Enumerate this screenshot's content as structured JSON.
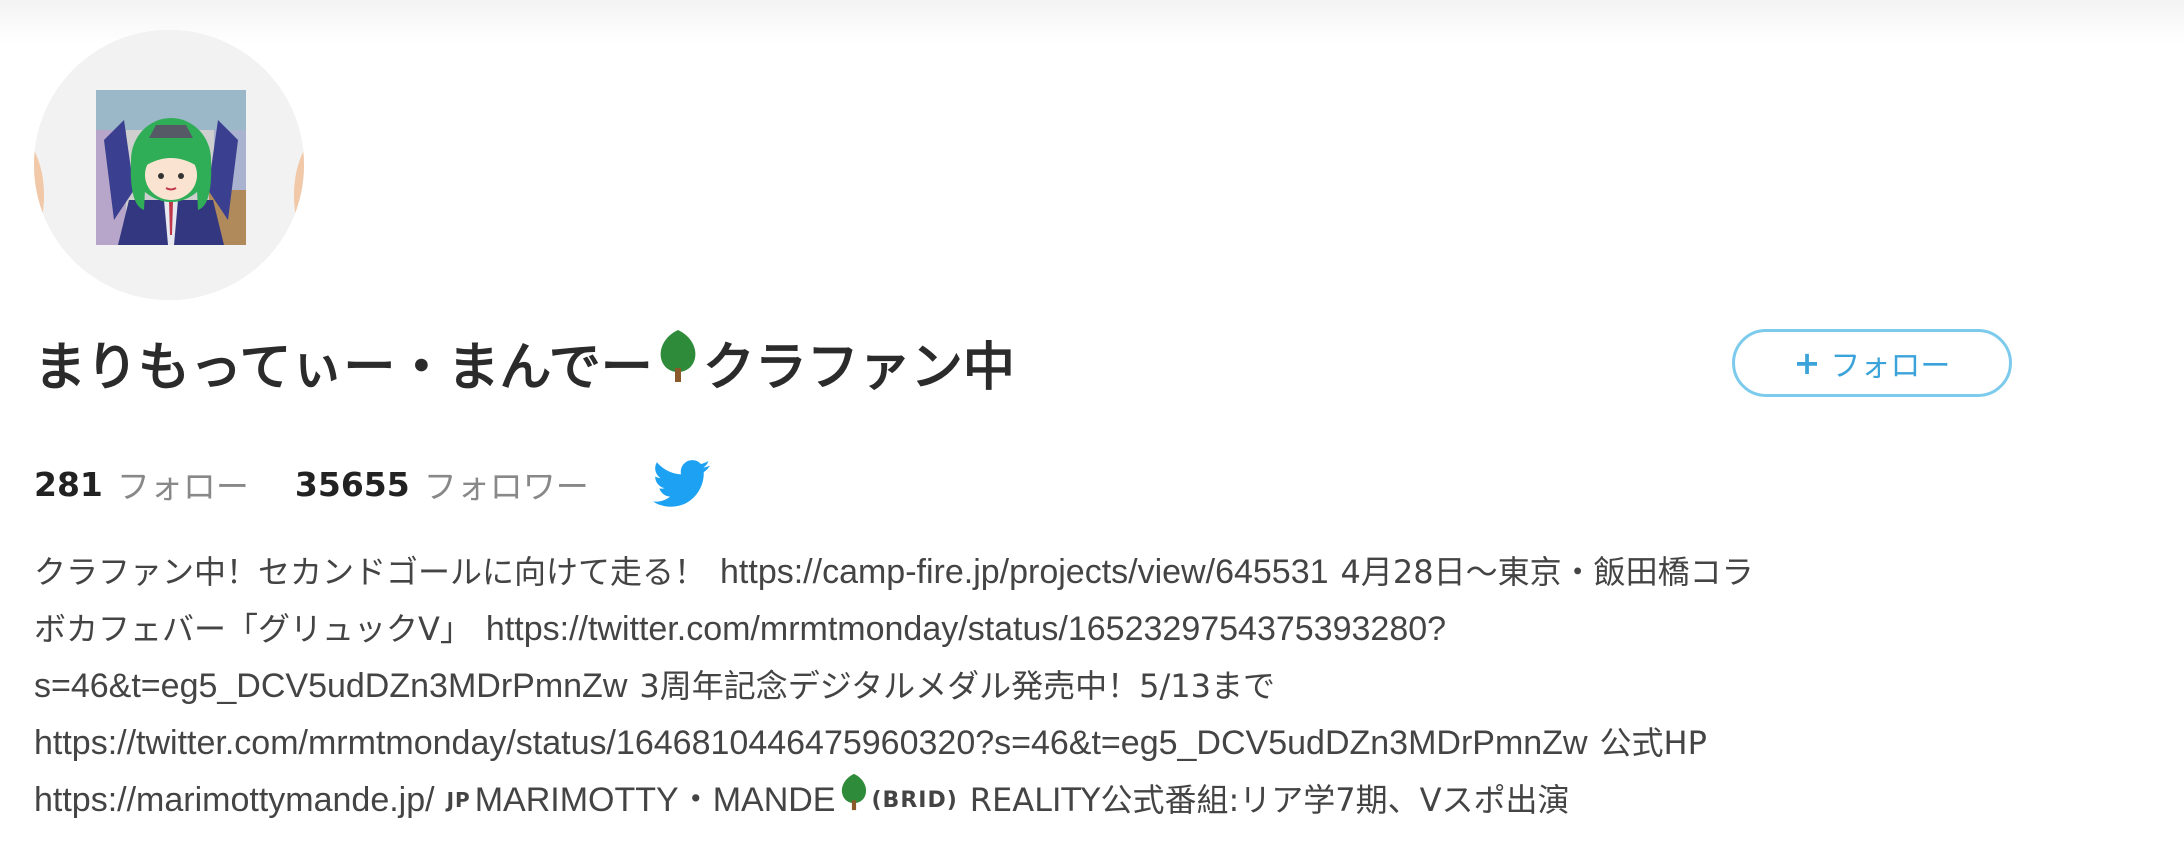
{
  "profile": {
    "display_name_part1": "まりもってぃー・まんでー",
    "display_name_part2": "クラファン中",
    "follow_button_label": "フォロー",
    "follow_button_icon": "plus-icon"
  },
  "stats": {
    "following_count": "281",
    "following_label": "フォロー",
    "followers_count": "35655",
    "followers_label": "フォロワー",
    "platform_icon": "twitter-bird-icon"
  },
  "bio": {
    "line1_text": "クラファン中！セカンドゴールに向けて走る！",
    "line1_url": "https://camp-fire.jp/projects/view/645531",
    "line1_tail": "4月28日〜東京・飯田橋コラ",
    "line2_text": "ボカフェバー「グリュックV」",
    "line2_url": "https://twitter.com/mrmtmonday/status/1652329754375393280?",
    "line3_url": "s=46&t=eg5_DCV5udDZn3MDrPmnZw",
    "line3_tail": "3周年記念デジタルメダル発売中！5/13まで",
    "line4_url": "https://twitter.com/mrmtmonday/status/1646810446475960320?s=46&t=eg5_DCV5udDZn3MDrPmnZw",
    "line4_tail": "公式HP",
    "line5_url": "https://marimottymande.jp/",
    "line5_flag": "JP",
    "line5_name": "MARIMOTTY・MANDE",
    "line5_brid": "(BRID)",
    "line5_tail": "REALITY公式番組:リア学7期、Vスポ出演"
  },
  "colors": {
    "accent": "#3ba3d9",
    "button_border": "#7ccbec",
    "twitter_blue": "#1da1f2",
    "tree_green": "#2e8b3a",
    "tree_trunk": "#8b5a2b"
  }
}
